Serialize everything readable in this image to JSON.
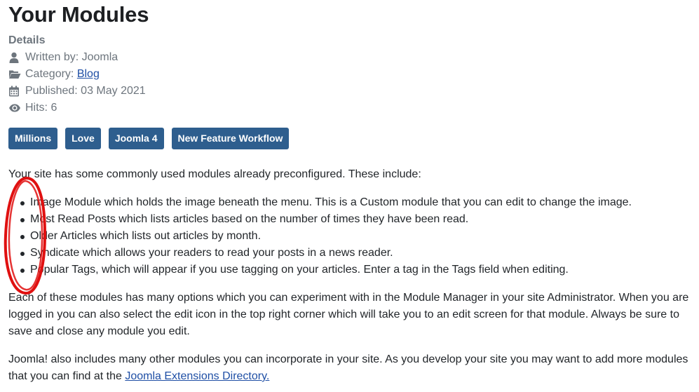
{
  "page": {
    "title": "Your Modules"
  },
  "details": {
    "heading": "Details",
    "written_by": "Written by: Joomla",
    "category_label": "Category: ",
    "category_link": "Blog",
    "published": "Published: 03 May 2021",
    "hits": "Hits: 6",
    "icons": [
      "user-icon",
      "folder-open-icon",
      "calendar-icon",
      "eye-icon"
    ]
  },
  "tags": [
    {
      "label": "Millions"
    },
    {
      "label": "Love"
    },
    {
      "label": "Joomla 4"
    },
    {
      "label": "New Feature Workflow"
    }
  ],
  "content": {
    "intro": "Your site has some commonly used modules already preconfigured. These include:",
    "modules": [
      "Image Module which holds the image beneath the menu. This is a Custom module that you can edit to change the image.",
      "Most Read Posts which lists articles based on the number of times they have been read.",
      "Older Articles which lists out articles by month.",
      "Syndicate which allows your readers to read your posts in a news reader.",
      "Popular Tags, which will appear if you use tagging on your articles. Enter a tag in the Tags field when editing."
    ],
    "paragraph2": "Each of these modules has many options which you can experiment with in the Module Manager in your site Administrator. When you are logged in you can also select the edit icon in the top right corner which will take you to an edit screen for that module. Always be sure to save and close any module you edit.",
    "paragraph3_text": "Joomla! also includes many other modules you can incorporate in your site. As you develop your site you may want to add more modules that you can find at the ",
    "paragraph3_link": "Joomla Extensions Directory."
  },
  "colors": {
    "tag_bg": "#2e5e8e",
    "link": "#1f4fa5",
    "meta_text": "#6d757d",
    "annotation": "#e01010"
  }
}
